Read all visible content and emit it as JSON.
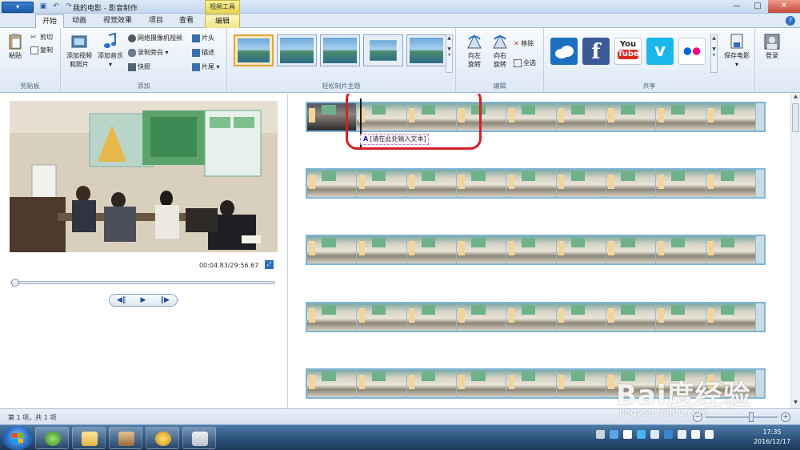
{
  "titlebar": {
    "app_menu_label": "▾",
    "title": "我的电影 - 影音制作",
    "context_tool": "视频工具",
    "minimize": "—",
    "maximize": "□",
    "close": "✕"
  },
  "tabs": [
    {
      "label": "开始"
    },
    {
      "label": "动画"
    },
    {
      "label": "视觉效果"
    },
    {
      "label": "项目"
    },
    {
      "label": "查看"
    },
    {
      "label": "编辑"
    }
  ],
  "ribbon": {
    "clipboard": {
      "label": "剪贴板",
      "paste": "粘贴",
      "cut": "剪切",
      "copy": "复制"
    },
    "add": {
      "label": "添加",
      "add_video_photo_line1": "添加视频",
      "add_video_photo_line2": "和照片",
      "add_music": "添加音乐",
      "webcam": "网络摄像机视频",
      "narration": "录制旁白",
      "snapshot": "快照",
      "title": "片头",
      "caption": "描述",
      "credits": "片尾"
    },
    "themes": {
      "label": "轻松制片主题"
    },
    "edit": {
      "label": "编辑",
      "rotate_left_line1": "向左",
      "rotate_left_line2": "旋转",
      "rotate_right_line1": "向右",
      "rotate_right_line2": "旋转",
      "remove": "移除",
      "select_all": "全选"
    },
    "share": {
      "label": "共享",
      "save_movie": "保存电影",
      "youtube_line1": "You",
      "youtube_line2": "Tube"
    },
    "account": {
      "sign_in": "登录"
    }
  },
  "preview": {
    "timecode": "00:04.83/29:56.67",
    "seek_progress": 0.0
  },
  "storyboard": {
    "caption_placeholder": "[请在此处输入文本]",
    "caption_icon_letter": "A"
  },
  "status": {
    "items_text": "第 1 项，共 1 项"
  },
  "watermark": {
    "brand": "Bai度经验",
    "url": "jingyan.baidu.com"
  },
  "taskbar": {
    "clock_time": "17:35",
    "clock_date": "2016/12/17"
  },
  "colors": {
    "accent": "#2c6fc2",
    "highlight_ring": "#d4202a",
    "strip_border": "#7fb5d8"
  }
}
